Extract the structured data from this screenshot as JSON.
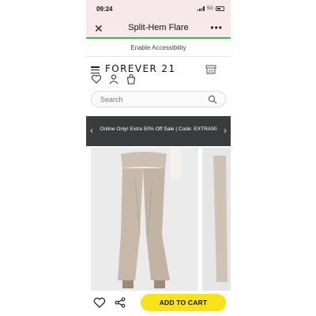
{
  "status_bar": {
    "time": "09:24",
    "network": "5G"
  },
  "title_bar": {
    "title": "Split-Hem Flare",
    "close_icon": "close-icon",
    "more_icon": "more-icon"
  },
  "accessibility": {
    "label": "Enable Accessibility"
  },
  "header": {
    "logo": "FOREVER 21",
    "menu_icon": "menu-icon",
    "store_icon": "store-icon",
    "icons": [
      "heart-icon",
      "account-icon",
      "bag-icon"
    ]
  },
  "search": {
    "placeholder": "Search"
  },
  "promo": {
    "text": "Online Only! Extra 50% Off Sale | Code: EXTRA50",
    "prev": "‹",
    "next": "›"
  },
  "bottom_bar": {
    "cart_label": "ADD TO CART",
    "wishlist_icon": "heart-icon",
    "share_icon": "share-icon"
  },
  "colors": {
    "title_bar_bg": "#f7e9e9",
    "progress_green": "#3dbb55",
    "promo_bg": "#3a3b3c",
    "cart_yellow": "#f7e21b"
  }
}
